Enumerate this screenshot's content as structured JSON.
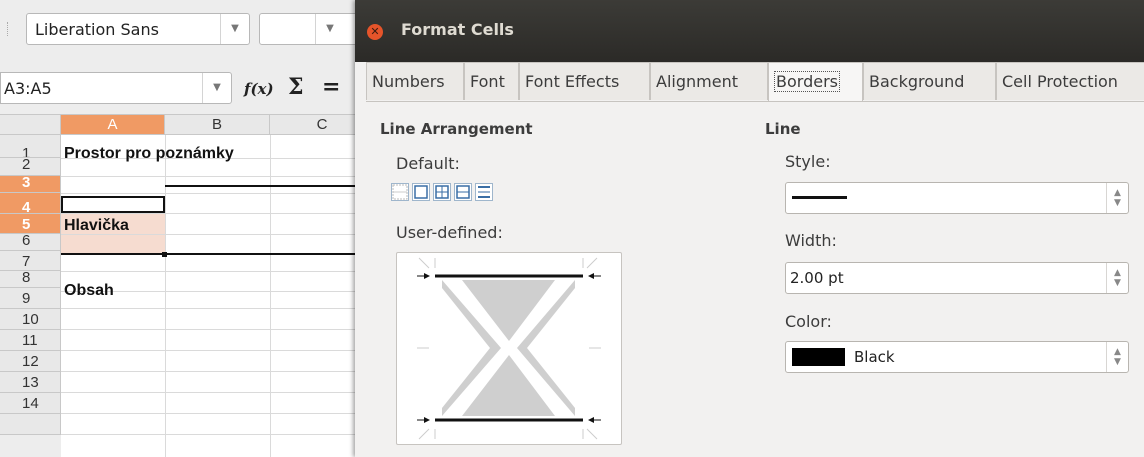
{
  "spreadsheet": {
    "font_name": "Liberation Sans",
    "font_size": "",
    "name_box": "A3:A5",
    "fx_symbol": "f(x)",
    "sigma_symbol": "Σ",
    "equals_symbol": "=",
    "columns": [
      "A",
      "B",
      "C"
    ],
    "selected_column": "A",
    "rows": [
      "1",
      "2",
      "3",
      "4",
      "5",
      "6",
      "7",
      "8",
      "9",
      "10",
      "11",
      "12",
      "13",
      "14"
    ],
    "selected_rows": [
      "3",
      "4",
      "5"
    ],
    "cells": {
      "a1": "Prostor pro poznámky",
      "a4": "Hlavička",
      "a7": "Obsah"
    }
  },
  "dialog": {
    "title": "Format Cells",
    "tabs": [
      "Numbers",
      "Font",
      "Font Effects",
      "Alignment",
      "Borders",
      "Background",
      "Cell Protection"
    ],
    "active_tab": "Borders",
    "line_arrangement": {
      "title": "Line Arrangement",
      "default_label": "Default:",
      "user_defined_label": "User-defined:",
      "presets": [
        "none",
        "outer-box",
        "outer-box-all-inner",
        "outer-box-horizontal",
        "top-bottom"
      ]
    },
    "line": {
      "title": "Line",
      "style_label": "Style:",
      "style_value": "solid",
      "width_label": "Width:",
      "width_value": "2.00 pt",
      "color_label": "Color:",
      "color_value": "Black",
      "color_hex": "#000000"
    }
  },
  "colors": {
    "selection_header": "#f09a64",
    "selection_fill": "#f6dcd0",
    "titlebar": "#3c3b37",
    "close_button": "#e5542a"
  }
}
